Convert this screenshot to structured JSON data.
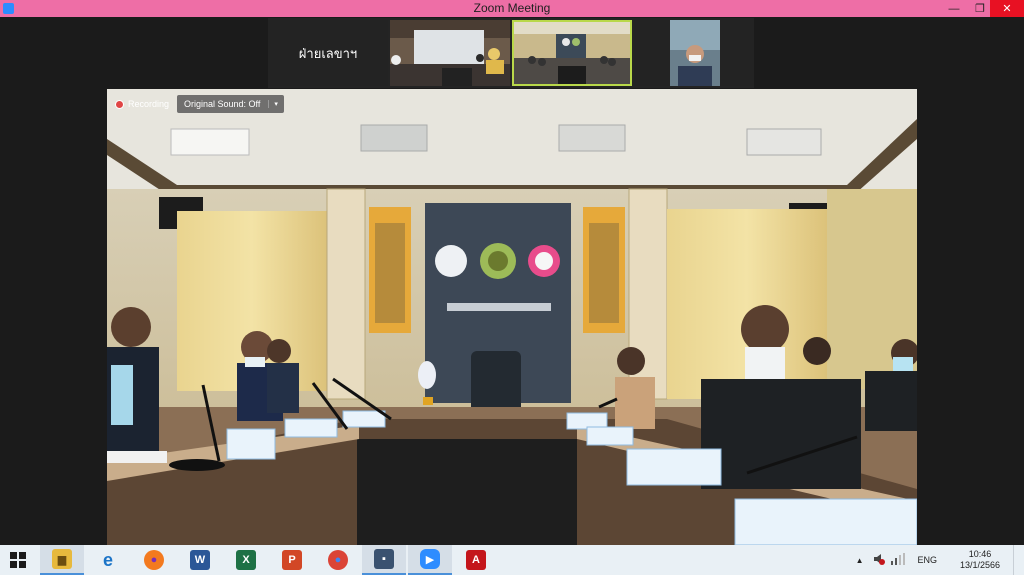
{
  "window": {
    "title": "Zoom Meeting",
    "minimize_glyph": "—",
    "restore_glyph": "❐",
    "close_glyph": "✕",
    "accent": "#ee6ea6"
  },
  "participants": {
    "name_tile": "ฝ่ายเลขาฯ"
  },
  "main_video": {
    "recording_label": "Recording",
    "original_sound_label": "Original Sound: Off",
    "dropdown_glyph": "▾"
  },
  "taskbar": {
    "apps": [
      {
        "name": "file-explorer",
        "glyph": "▆"
      },
      {
        "name": "internet-explorer",
        "glyph": "e"
      },
      {
        "name": "firefox",
        "glyph": "●"
      },
      {
        "name": "word",
        "glyph": "W"
      },
      {
        "name": "excel",
        "glyph": "X"
      },
      {
        "name": "powerpoint",
        "glyph": "P"
      },
      {
        "name": "chrome",
        "glyph": "●"
      },
      {
        "name": "app",
        "glyph": "▪"
      },
      {
        "name": "zoom",
        "glyph": "▶"
      },
      {
        "name": "acrobat",
        "glyph": "A"
      }
    ],
    "tray": {
      "chevron": "▲",
      "language": "ENG",
      "time": "10:46",
      "date": "13/1/2566"
    }
  }
}
